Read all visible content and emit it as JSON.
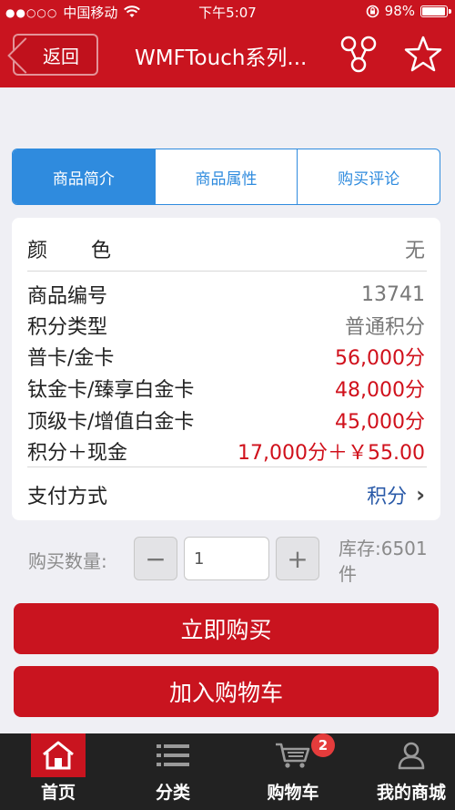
{
  "status": {
    "carrier": "中国移动",
    "time": "下午5:07",
    "battery": "98%",
    "battery_level": 0.98
  },
  "nav": {
    "back_label": "返回",
    "title": "WMFTouch系列..."
  },
  "tabs": [
    {
      "label": "商品简介",
      "active": true
    },
    {
      "label": "商品属性",
      "active": false
    },
    {
      "label": "购买评论",
      "active": false
    }
  ],
  "info": {
    "color_label_1": "颜",
    "color_label_2": "色",
    "color_value": "无",
    "rows": [
      {
        "label": "商品编号",
        "value": "13741"
      },
      {
        "label": "积分类型",
        "value": "普通积分"
      },
      {
        "label": "普卡/金卡",
        "value": "56,000分"
      },
      {
        "label": "钛金卡/臻享白金卡",
        "value": "48,000分"
      },
      {
        "label": "顶级卡/增值白金卡",
        "value": "45,000分"
      },
      {
        "label": "积分＋现金",
        "value": "17,000分＋￥55.00"
      }
    ],
    "pay_label": "支付方式",
    "pay_value": "积分"
  },
  "quantity": {
    "label": "购买数量:",
    "minus": "−",
    "plus": "+",
    "value": "1",
    "stock": "库存:6501件"
  },
  "actions": {
    "buy_now": "立即购买",
    "add_cart": "加入购物车"
  },
  "tabbar": {
    "items": [
      {
        "label": "首页",
        "icon": "home-icon"
      },
      {
        "label": "分类",
        "icon": "list-icon"
      },
      {
        "label": "购物车",
        "icon": "cart-icon"
      },
      {
        "label": "我的商城",
        "icon": "user-icon"
      }
    ],
    "cart_badge": "2"
  },
  "colors": {
    "brand_red": "#c9141f",
    "tab_blue": "#2f8bde",
    "price_red": "#d0101b"
  }
}
